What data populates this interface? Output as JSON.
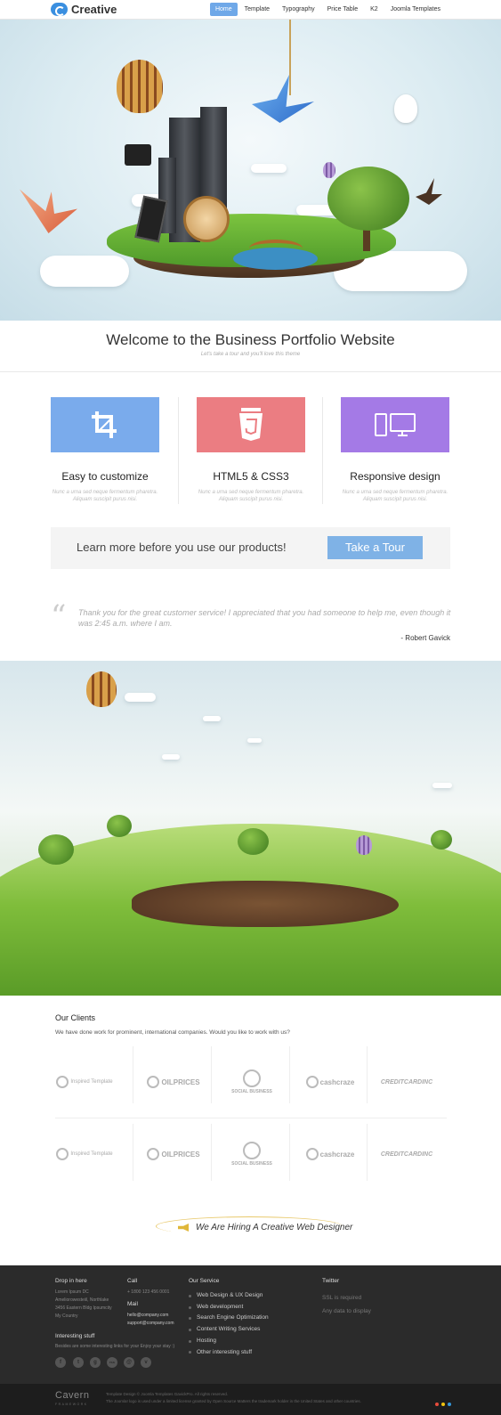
{
  "header": {
    "logo": "Creative",
    "nav": [
      "Home",
      "Template",
      "Typography",
      "Price Table",
      "K2",
      "Joomla Templates"
    ],
    "active_index": 0
  },
  "welcome": {
    "title": "Welcome to the Business Portfolio Website",
    "subtitle": "Let's take a tour and you'll love this theme"
  },
  "features": [
    {
      "title": "Easy to customize",
      "text": "Nunc a urna sed neque fermentum pharetra. Aliquam suscipit purus nisi.",
      "color": "#7aabec",
      "icon": "crop-icon"
    },
    {
      "title": "HTML5 & CSS3",
      "text": "Nunc a urna sed neque fermentum pharetra. Aliquam suscipit purus nisi.",
      "color": "#eb7d82",
      "icon": "html5-icon"
    },
    {
      "title": "Responsive design",
      "text": "Nunc a urna sed neque fermentum pharetra. Aliquam suscipit purus nisi.",
      "color": "#a47ae6",
      "icon": "devices-icon"
    }
  ],
  "cta": {
    "text": "Learn more before you use our products!",
    "button": "Take a Tour"
  },
  "testimonial": {
    "quote": "Thank you for the great customer service! I appreciated that you had someone to help me, even though it was 2:45 a.m. where I am.",
    "author": "- Robert Gavick"
  },
  "clients": {
    "title": "Our Clients",
    "text": "We have done work for prominent, international companies. Would you like to work with us?",
    "logos": [
      "Inspired Template",
      "OILPRICES",
      "SOCIAL BUSINESS",
      "cashcraze",
      "CREDITCARDINC"
    ]
  },
  "hiring": "We Are Hiring A Creative Web Designer",
  "footer": {
    "drop_title": "Drop in here",
    "address": [
      "Lorem Ipsum DC",
      "Ameliorowesteiil, Northlake",
      "3456 Eastern Bldg Ipsumcity",
      "My Country"
    ],
    "call_title": "Call",
    "phone": "+ 1800 123 456 0001",
    "mail_title": "Mail",
    "emails": [
      "hello@company.com",
      "support@company.com"
    ],
    "interesting_title": "Interesting stuff",
    "interesting_text": "Besides are some interesting links for your Enjoy your stay :)",
    "service_title": "Our Service",
    "services": [
      "Web Design & UX Design",
      "Web development",
      "Search Engine Optimization",
      "Content Writing Services",
      "Hosting",
      "Other interesting stuff"
    ],
    "twitter_title": "Twitter",
    "twitter_lines": [
      "SSL is required",
      "Any data to display"
    ],
    "socials": [
      "f",
      "t",
      "g",
      "rss",
      "@",
      "v"
    ]
  },
  "bottom": {
    "brand": "Cavern",
    "brand_sub": "FRAMEWORK",
    "legal1": "Template Design © Joomla Templates GavickPro. All rights reserved.",
    "legal2": "The Joomla! logo is used under a limited license granted by Open Source Matters the trademark holder in the United States and other countries.",
    "dot_colors": [
      "#e74c3c",
      "#f1c40f",
      "#3498db"
    ]
  }
}
